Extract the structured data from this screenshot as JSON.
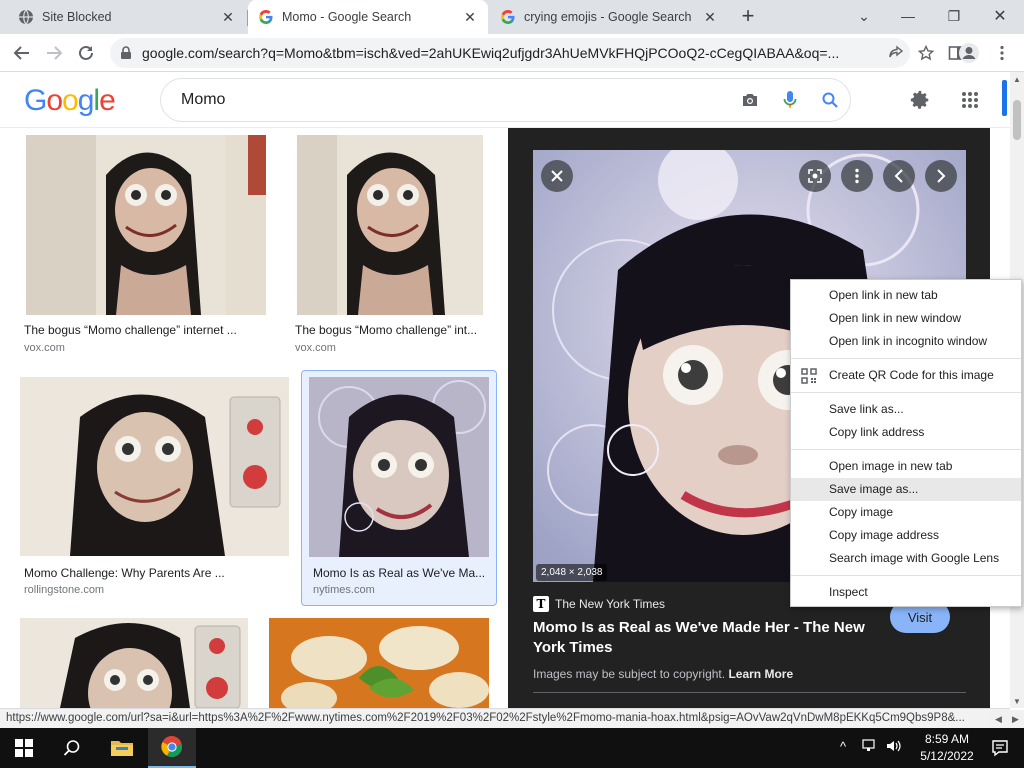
{
  "browser": {
    "tabs": [
      {
        "title": "Site Blocked",
        "active": false
      },
      {
        "title": "Momo - Google Search",
        "active": true
      },
      {
        "title": "crying emojis - Google Search",
        "active": false
      }
    ],
    "url": "google.com/search?q=Momo&tbm=isch&ved=2ahUKEwiq2ufjgdr3AhUeMVkFHQjPCOoQ2-cCegQIABAA&oq=..."
  },
  "google": {
    "logo": "Google",
    "query": "Momo",
    "colors": {
      "blue": "#4285F4",
      "red": "#EA4335",
      "yellow": "#FBBC05",
      "green": "#34A853"
    }
  },
  "results": [
    {
      "title": "The bogus “Momo challenge” internet ...",
      "source": "vox.com"
    },
    {
      "title": "The bogus “Momo challenge” int...",
      "source": "vox.com"
    },
    {
      "title": "Momo Challenge: Why Parents Are ...",
      "source": "rollingstone.com"
    },
    {
      "title": "Momo Is as Real as We've Ma...",
      "source": "nytimes.com"
    }
  ],
  "preview": {
    "dimensions": "2,048 × 2,038",
    "source": "The New York Times",
    "title": "Momo Is as Real as We've Made Her - The New York Times",
    "visit_label": "Visit",
    "copyright_text": "Images may be subject to copyright.",
    "learn_more": "Learn More"
  },
  "context_menu": {
    "groups": [
      [
        "Open link in new tab",
        "Open link in new window",
        "Open link in incognito window"
      ],
      [
        "Create QR Code for this image"
      ],
      [
        "Save link as...",
        "Copy link address"
      ],
      [
        "Open image in new tab",
        "Save image as...",
        "Copy image",
        "Copy image address",
        "Search image with Google Lens"
      ],
      [
        "Inspect"
      ]
    ],
    "hovered": "Save image as..."
  },
  "status_url": "https://www.google.com/url?sa=i&url=https%3A%2F%2Fwww.nytimes.com%2F2019%2F03%2F02%2Fstyle%2Fmomo-mania-hoax.html&psig=AOvVaw2qVnDwM8pEKKq5Cm9Qbs9P8&...",
  "taskbar": {
    "time": "8:59 AM",
    "date": "5/12/2022"
  }
}
